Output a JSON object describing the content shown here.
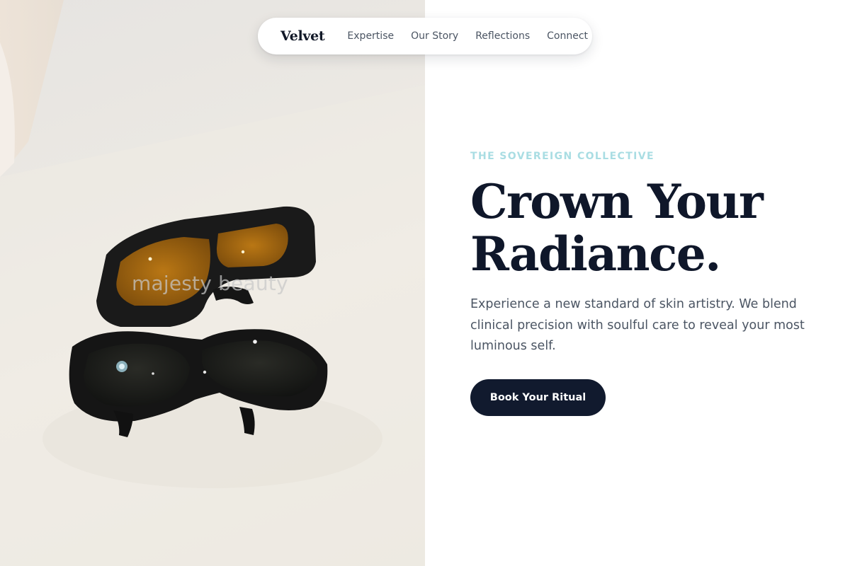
{
  "nav": {
    "brand": "Velvet",
    "links": [
      "Expertise",
      "Our Story",
      "Reflections",
      "Connect"
    ]
  },
  "hero": {
    "eyebrow": "THE SOVEREIGN COLLECTIVE",
    "headline_line1": "Crown Your",
    "headline_line2": "Radiance.",
    "subtext": "Experience a new standard of skin artistry. We blend clinical precision with soulful care to reveal your most luminous self.",
    "cta_label": "Book Your Ritual",
    "image_watermark": "majesty beauty"
  },
  "colors": {
    "eyebrow": "#a9dde3",
    "headline": "#0f172a",
    "body_text": "#4b5563",
    "cta_background": "#111a2e",
    "cta_text": "#ffffff"
  },
  "icons": {
    "image_subject": "safety-glasses-photo"
  }
}
